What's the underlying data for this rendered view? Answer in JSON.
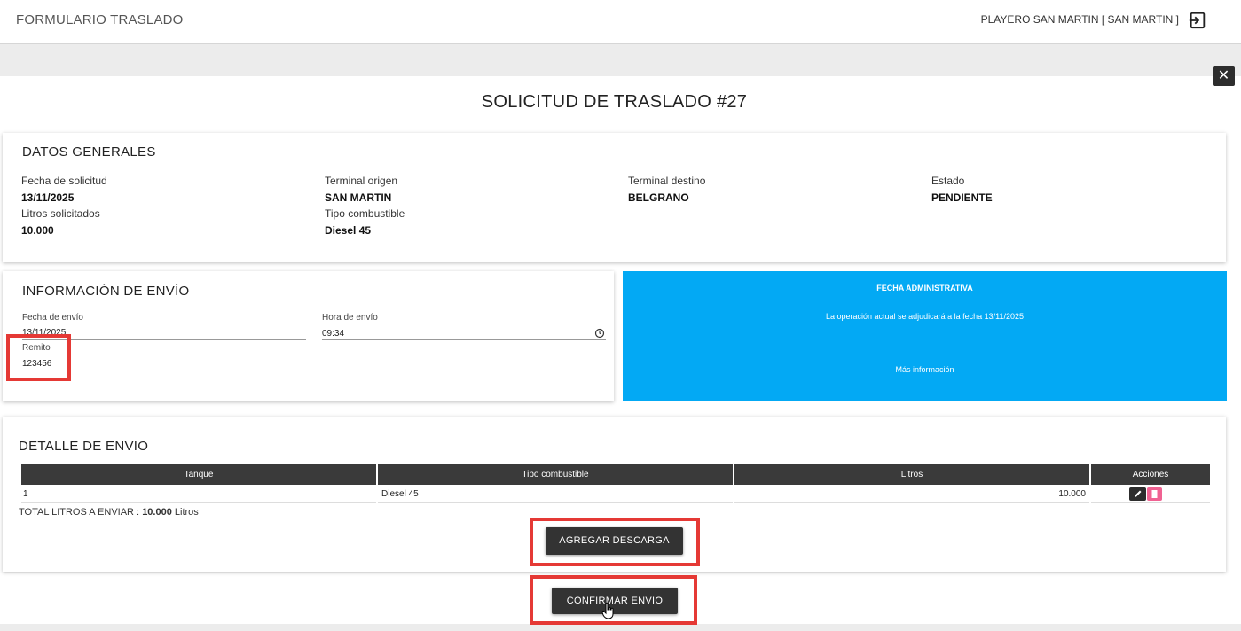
{
  "topbar": {
    "app_title": "FORMULARIO TRASLADO",
    "user": "PLAYERO SAN MARTIN [ SAN MARTIN ]",
    "logout_icon": "logout-icon"
  },
  "modal": {
    "close_label": "✕",
    "title": "SOLICITUD DE TRASLADO #27"
  },
  "general": {
    "section_title": "DATOS GENERALES",
    "fecha_solicitud_label": "Fecha de solicitud",
    "fecha_solicitud": "13/11/2025",
    "litros_solicitados_label": "Litros solicitados",
    "litros_solicitados": "10.000",
    "terminal_origen_label": "Terminal origen",
    "terminal_origen": "SAN MARTIN",
    "tipo_combustible_label": "Tipo combustible",
    "tipo_combustible": "Diesel 45",
    "terminal_destino_label": "Terminal destino",
    "terminal_destino": "BELGRANO",
    "estado_label": "Estado",
    "estado": "PENDIENTE"
  },
  "envio": {
    "section_title": "INFORMACIÓN DE ENVÍO",
    "fecha_envio_label": "Fecha de envío",
    "fecha_envio": "13/11/2025",
    "hora_envio_label": "Hora de envío",
    "hora_envio": "09:34",
    "remito_label": "Remito",
    "remito": "123456"
  },
  "admin_info": {
    "title": "FECHA ADMINISTRATIVA",
    "message": "La operación actual se adjudicará a la fecha 13/11/2025",
    "more_link": "Más información",
    "color": "#03a9f4"
  },
  "detalle": {
    "section_title": "DETALLE DE ENVIO",
    "columns": [
      "Tanque",
      "Tipo combustible",
      "Litros",
      "Acciones"
    ],
    "rows": [
      {
        "tanque": "1",
        "tipo": "Diesel 45",
        "litros": "10.000"
      }
    ],
    "total_prefix": "TOTAL LITROS A ENVIAR :",
    "total_value": "10.000",
    "total_unit": "Litros",
    "add_button": "AGREGAR DESCARGA"
  },
  "confirm_button": "CONFIRMAR ENVIO",
  "colors": {
    "highlight": "#e53935",
    "dark_button": "#333333",
    "delete_action": "#f06292"
  }
}
